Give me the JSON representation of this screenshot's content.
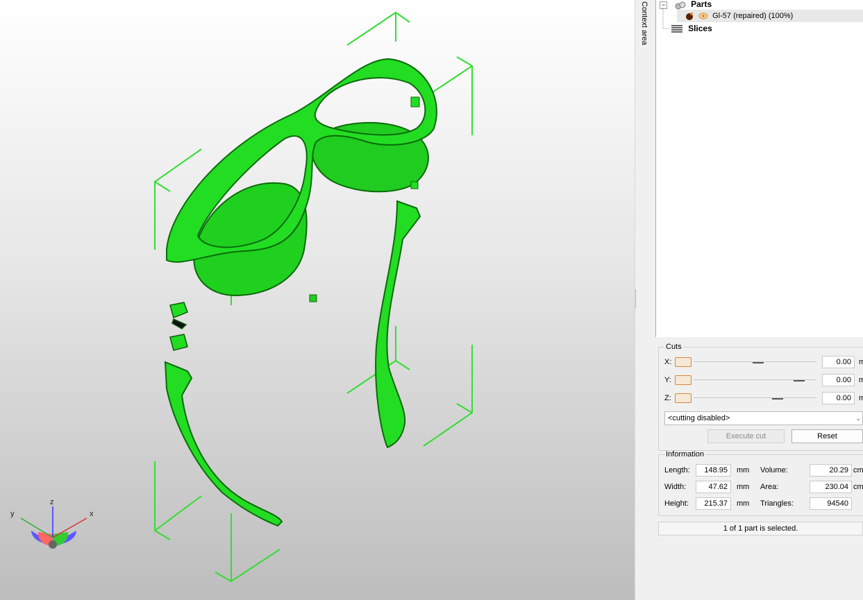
{
  "viewport": {
    "axes": {
      "x": "x",
      "y": "y",
      "z": "z"
    },
    "model_color": "#22dd22"
  },
  "side_tab": {
    "label": "Context area"
  },
  "tree": {
    "items": [
      {
        "label": "Parts",
        "icon": "parts-icon"
      },
      {
        "label": "Gl-57 (repaired) (100%)",
        "icon": "part-icon"
      },
      {
        "label": "Slices",
        "icon": "slices-icon"
      }
    ]
  },
  "cuts": {
    "title": "Cuts",
    "rows": [
      {
        "axis": "X:",
        "value": "0.00",
        "unit": "m"
      },
      {
        "axis": "Y:",
        "value": "0.00",
        "unit": "m"
      },
      {
        "axis": "Z:",
        "value": "0.00",
        "unit": "m"
      }
    ],
    "mode": "<cutting disabled>",
    "execute_label": "Execute cut",
    "reset_label": "Reset"
  },
  "info": {
    "title": "Information",
    "length_label": "Length:",
    "length_value": "148.95",
    "length_unit": "mm",
    "width_label": "Width:",
    "width_value": "47.62",
    "width_unit": "mm",
    "height_label": "Height:",
    "height_value": "215.37",
    "height_unit": "mm",
    "volume_label": "Volume:",
    "volume_value": "20.29",
    "volume_unit": "cm",
    "area_label": "Area:",
    "area_value": "230.04",
    "area_unit": "cm",
    "triangles_label": "Triangles:",
    "triangles_value": "94540"
  },
  "status": "1 of 1 part is selected."
}
